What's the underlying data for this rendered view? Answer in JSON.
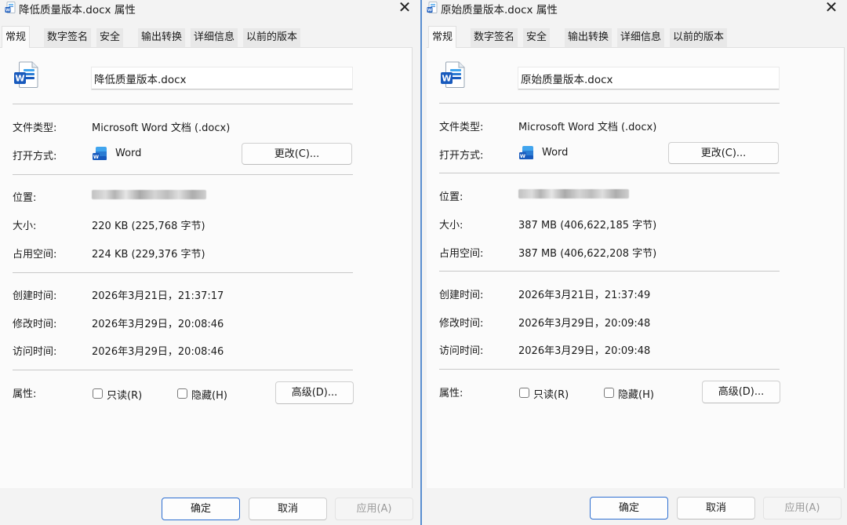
{
  "dialogs": [
    {
      "title": "降低质量版本.docx 属性",
      "tabs": [
        "常规",
        "数字签名",
        "安全",
        "输出转换",
        "详细信息",
        "以前的版本"
      ],
      "active_tab": "常规",
      "file_name": "降低质量版本.docx",
      "labels": {
        "file_type": "文件类型:",
        "open_with": "打开方式:",
        "location": "位置:",
        "size": "大小:",
        "size_on_disk": "占用空间:",
        "created": "创建时间:",
        "modified": "修改时间:",
        "accessed": "访问时间:",
        "attributes": "属性:"
      },
      "file_type": "Microsoft Word 文档 (.docx)",
      "open_with_app": "Word",
      "change_button": "更改(C)...",
      "size": "220 KB (225,768 字节)",
      "size_on_disk": "224 KB (229,376 字节)",
      "created": "2026年3月21日，21:37:17",
      "modified": "2026年3月29日，20:08:46",
      "accessed": "2026年3月29日，20:08:46",
      "readonly_label": "只读(R)",
      "hidden_label": "隐藏(H)",
      "advanced_button": "高级(D)...",
      "ok_button": "确定",
      "cancel_button": "取消",
      "apply_button": "应用(A)"
    },
    {
      "title": "原始质量版本.docx 属性",
      "tabs": [
        "常规",
        "数字签名",
        "安全",
        "输出转换",
        "详细信息",
        "以前的版本"
      ],
      "active_tab": "常规",
      "file_name": "原始质量版本.docx",
      "labels": {
        "file_type": "文件类型:",
        "open_with": "打开方式:",
        "location": "位置:",
        "size": "大小:",
        "size_on_disk": "占用空间:",
        "created": "创建时间:",
        "modified": "修改时间:",
        "accessed": "访问时间:",
        "attributes": "属性:"
      },
      "file_type": "Microsoft Word 文档 (.docx)",
      "open_with_app": "Word",
      "change_button": "更改(C)...",
      "size": "387 MB (406,622,185 字节)",
      "size_on_disk": "387 MB (406,622,208 字节)",
      "created": "2026年3月21日，21:37:49",
      "modified": "2026年3月29日，20:09:48",
      "accessed": "2026年3月29日，20:09:48",
      "readonly_label": "只读(R)",
      "hidden_label": "隐藏(H)",
      "advanced_button": "高级(D)...",
      "ok_button": "确定",
      "cancel_button": "取消",
      "apply_button": "应用(A)"
    }
  ],
  "icons": {
    "close": "close-icon",
    "word_doc": "word-document-icon",
    "word_app": "word-app-icon"
  },
  "colors": {
    "word_blue": "#185abd",
    "word_light": "#41a5ee",
    "accent": "#2e6fd1",
    "window_divider": "#5a8ed0"
  }
}
